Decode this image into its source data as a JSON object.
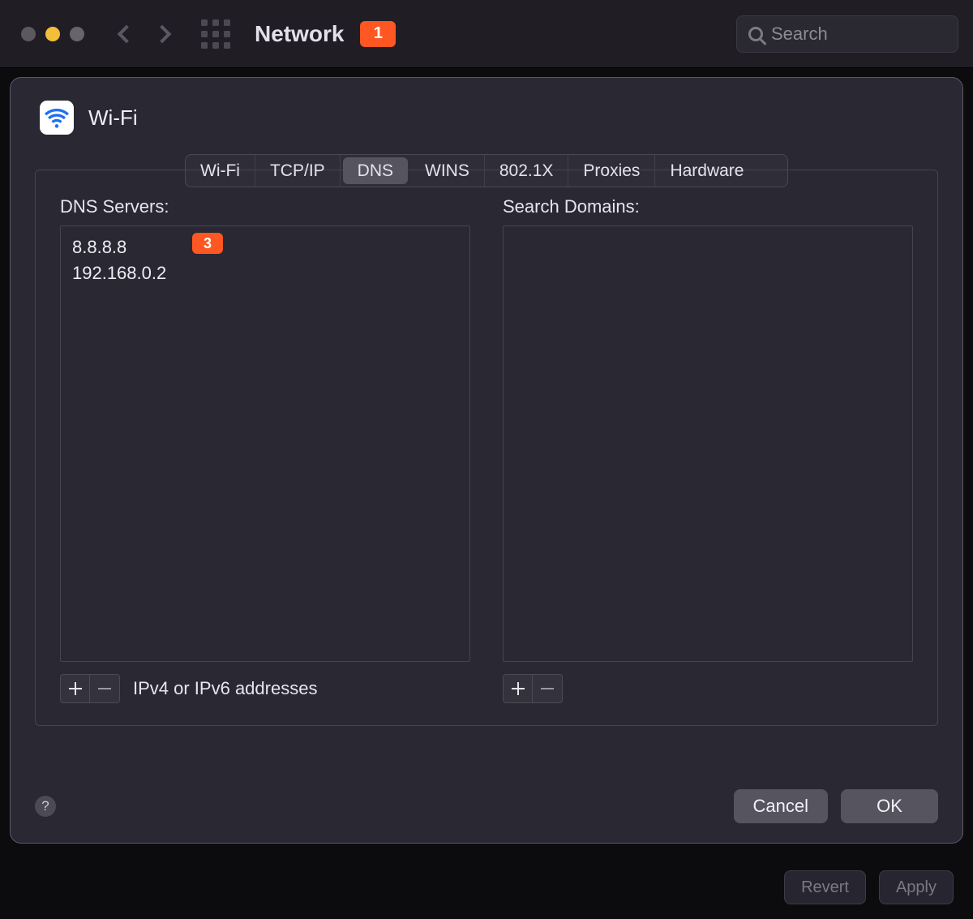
{
  "toolbar": {
    "title": "Network",
    "callout_1": "1",
    "search_placeholder": "Search"
  },
  "sheet": {
    "connection_name": "Wi-Fi",
    "tabs": [
      "Wi-Fi",
      "TCP/IP",
      "DNS",
      "WINS",
      "802.1X",
      "Proxies",
      "Hardware"
    ],
    "active_tab": "DNS",
    "dns": {
      "servers_label": "DNS Servers:",
      "servers": [
        "8.8.8.8",
        "192.168.0.2"
      ],
      "callout_3": "3",
      "hint": "IPv4 or IPv6 addresses",
      "search_domains_label": "Search Domains:",
      "search_domains": []
    },
    "buttons": {
      "help": "?",
      "cancel": "Cancel",
      "ok": "OK"
    }
  },
  "background_buttons": {
    "revert": "Revert",
    "apply": "Apply"
  }
}
